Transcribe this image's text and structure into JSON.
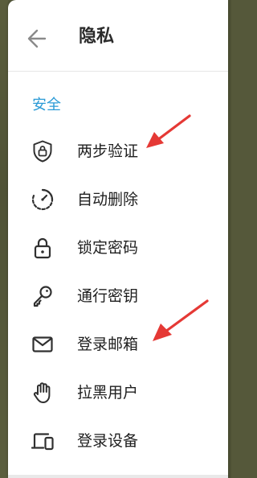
{
  "header": {
    "title": "隐私",
    "back_icon": "back-arrow-icon"
  },
  "section": {
    "label": "安全"
  },
  "menu": [
    {
      "label": "两步验证",
      "icon": "shield-lock-icon"
    },
    {
      "label": "自动删除",
      "icon": "timer-icon"
    },
    {
      "label": "锁定密码",
      "icon": "padlock-icon"
    },
    {
      "label": "通行密钥",
      "icon": "key-icon"
    },
    {
      "label": "登录邮箱",
      "icon": "mail-icon"
    },
    {
      "label": "拉黑用户",
      "icon": "hand-icon"
    },
    {
      "label": "登录设备",
      "icon": "devices-icon"
    }
  ],
  "colors": {
    "accent": "#2a9ad6",
    "annotation": "#e53935"
  }
}
